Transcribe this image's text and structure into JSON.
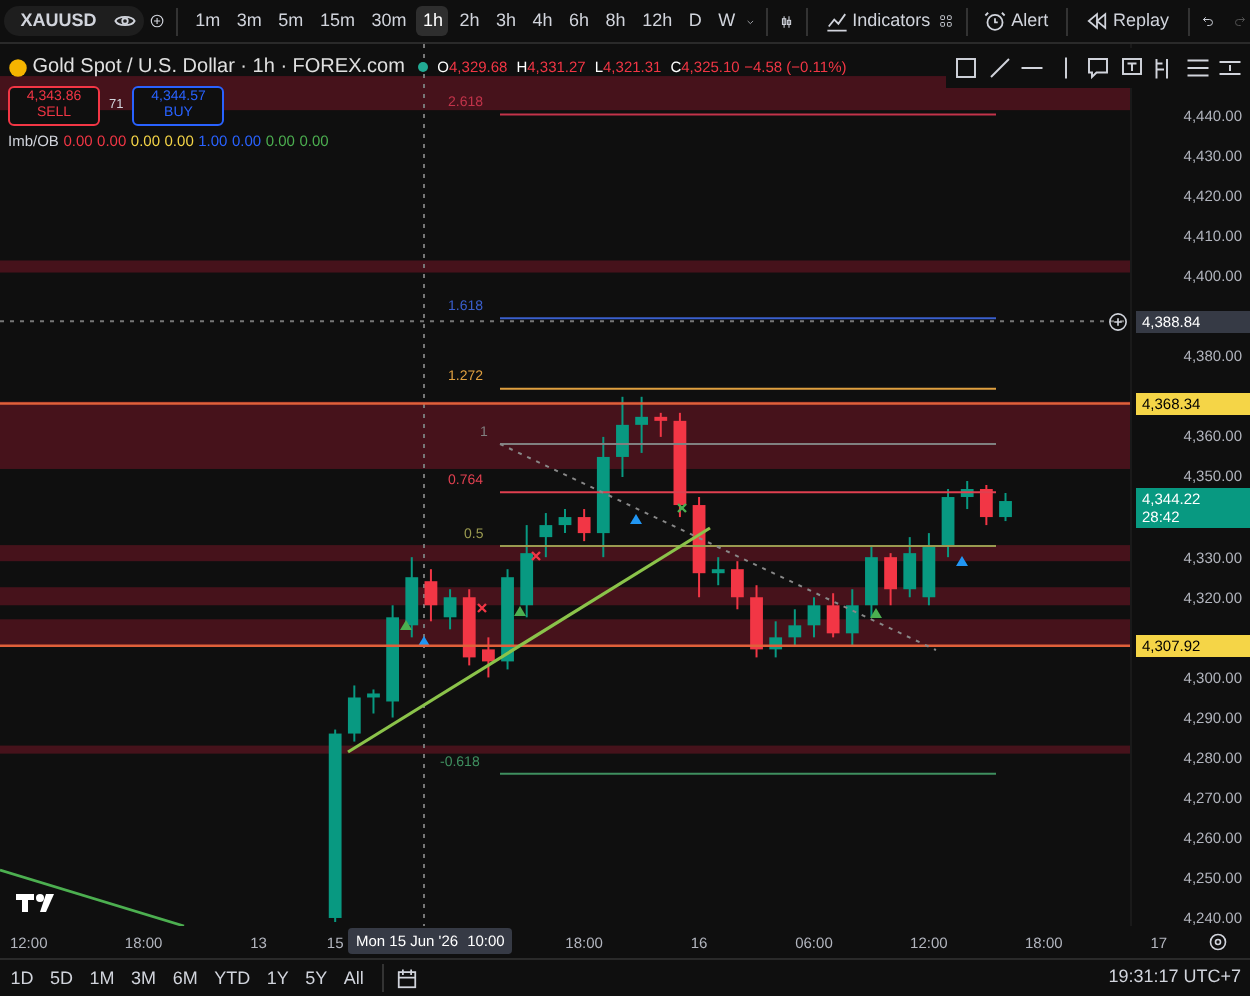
{
  "toolbar": {
    "symbol": "XAUUSD",
    "intervals": [
      {
        "label": "1m",
        "selected": false
      },
      {
        "label": "3m",
        "selected": false
      },
      {
        "label": "5m",
        "selected": false
      },
      {
        "label": "15m",
        "selected": false
      },
      {
        "label": "30m",
        "selected": false
      },
      {
        "label": "1h",
        "selected": true
      },
      {
        "label": "2h",
        "selected": false
      },
      {
        "label": "3h",
        "selected": false
      },
      {
        "label": "4h",
        "selected": false
      },
      {
        "label": "6h",
        "selected": false
      },
      {
        "label": "8h",
        "selected": false
      },
      {
        "label": "12h",
        "selected": false
      },
      {
        "label": "D",
        "selected": false
      },
      {
        "label": "W",
        "selected": false
      }
    ],
    "buttons": [
      {
        "kind": "indicators",
        "label": "Indicators"
      },
      {
        "kind": "alert",
        "label": "Alert"
      },
      {
        "kind": "replay",
        "label": "Replay"
      }
    ]
  },
  "legend": {
    "title": "Gold Spot / U.S. Dollar · 1h · FOREX.com",
    "ohlc": [
      {
        "key": "O",
        "value": "4,329.68"
      },
      {
        "key": "H",
        "value": "4,331.27"
      },
      {
        "key": "L",
        "value": "4,321.31"
      },
      {
        "key": "C",
        "value": "4,325.10"
      }
    ],
    "change": "−4.58 (−0.11%)",
    "sell": {
      "price": "4,343.86",
      "label": "SELL"
    },
    "spread": "71",
    "buy": {
      "price": "4,344.57",
      "label": "BUY"
    },
    "indicator": {
      "name": "Imb/OB",
      "values": [
        {
          "text": "0.00",
          "color": "#f23645"
        },
        {
          "text": "0.00",
          "color": "#f23645"
        },
        {
          "text": "0.00",
          "color": "#f5d547"
        },
        {
          "text": "0.00",
          "color": "#f5d547"
        },
        {
          "text": "1.00",
          "color": "#2962ff"
        },
        {
          "text": "0.00",
          "color": "#2962ff"
        },
        {
          "text": "0.00",
          "color": "#4caf50"
        },
        {
          "text": "0.00",
          "color": "#4caf50"
        }
      ]
    }
  },
  "chart": {
    "chart_data": {
      "type": "candlestick",
      "categories": [
        null,
        null,
        null,
        null,
        null,
        null,
        null,
        null,
        null,
        null,
        null,
        null,
        null,
        null,
        null,
        null,
        null,
        null,
        null,
        null,
        null,
        null,
        null,
        null,
        null,
        null,
        null,
        null,
        null,
        null,
        null,
        null,
        null,
        null,
        null,
        null,
        null,
        null,
        null,
        null,
        null,
        null,
        null,
        null,
        null,
        null,
        null,
        null,
        null,
        null,
        null,
        null,
        null,
        null,
        null,
        null,
        null,
        null,
        null
      ],
      "ylim": [
        4238,
        4458
      ],
      "ohlc": [
        null,
        null,
        null,
        null,
        null,
        null,
        null,
        null,
        null,
        null,
        null,
        null,
        null,
        null,
        null,
        null,
        null,
        [
          4240,
          4287,
          4239,
          4286
        ],
        [
          4286,
          4298,
          4284,
          4295
        ],
        [
          4295,
          4297,
          4291,
          4296
        ],
        [
          4294,
          4318,
          4290,
          4315
        ],
        [
          4313,
          4330,
          4310,
          4325
        ],
        [
          4324,
          4327,
          4314,
          4318
        ],
        [
          4315,
          4322,
          4312,
          4320
        ],
        [
          4320,
          4322,
          4303,
          4305
        ],
        [
          4307,
          4310,
          4300,
          4304
        ],
        [
          4304,
          4327,
          4302,
          4325
        ],
        [
          4318,
          4338,
          4315,
          4331
        ],
        [
          4335,
          4341,
          4330,
          4338
        ],
        [
          4338,
          4342,
          4336,
          4340
        ],
        [
          4340,
          4342,
          4334,
          4336
        ],
        [
          4336,
          4360,
          4330,
          4355
        ],
        [
          4355,
          4370,
          4350,
          4363
        ],
        [
          4363,
          4370,
          4356,
          4365
        ],
        [
          4365,
          4366,
          4360,
          4364
        ],
        [
          4364,
          4366,
          4340,
          4343
        ],
        [
          4343,
          4345,
          4320,
          4326
        ],
        [
          4326,
          4330,
          4323,
          4327
        ],
        [
          4327,
          4329,
          4317,
          4320
        ],
        [
          4320,
          4323,
          4305,
          4307
        ],
        [
          4307,
          4314,
          4305,
          4310
        ],
        [
          4310,
          4317,
          4308,
          4313
        ],
        [
          4313,
          4320,
          4310,
          4318
        ],
        [
          4318,
          4321,
          4310,
          4311
        ],
        [
          4311,
          4322,
          4308,
          4318
        ],
        [
          4318,
          4333,
          4315,
          4330
        ],
        [
          4330,
          4331,
          4318,
          4322
        ],
        [
          4322,
          4335,
          4320,
          4331
        ],
        [
          4320,
          4336,
          4318,
          4333
        ],
        [
          4333,
          4347,
          4330,
          4345
        ],
        [
          4345,
          4349,
          4342,
          4347
        ],
        [
          4347,
          4348,
          4338,
          4340
        ],
        [
          4340,
          4346,
          4339,
          4344
        ],
        null,
        null,
        null,
        null,
        null,
        null
      ],
      "yticks": [
        {
          "value": 4440,
          "label": "4,440.00"
        },
        {
          "value": 4430,
          "label": "4,430.00"
        },
        {
          "value": 4420,
          "label": "4,420.00"
        },
        {
          "value": 4410,
          "label": "4,410.00"
        },
        {
          "value": 4400,
          "label": "4,400.00"
        },
        {
          "value": 4380,
          "label": "4,380.00"
        },
        {
          "value": 4360,
          "label": "4,360.00"
        },
        {
          "value": 4350,
          "label": "4,350.00"
        },
        {
          "value": 4330,
          "label": "4,330.00"
        },
        {
          "value": 4320,
          "label": "4,320.00"
        },
        {
          "value": 4300,
          "label": "4,300.00"
        },
        {
          "value": 4290,
          "label": "4,290.00"
        },
        {
          "value": 4280,
          "label": "4,280.00"
        },
        {
          "value": 4270,
          "label": "4,270.00"
        },
        {
          "value": 4260,
          "label": "4,260.00"
        },
        {
          "value": 4250,
          "label": "4,250.00"
        },
        {
          "value": 4240,
          "label": "4,240.00"
        }
      ]
    }
  },
  "fib_levels": [
    {
      "label": "2.618",
      "color": "#c2334a"
    },
    {
      "label": "1.618",
      "color": "#3a5fcd"
    },
    {
      "label": "1.272",
      "color": "#e0a040"
    },
    {
      "label": "1",
      "color": "#808080"
    },
    {
      "label": "0.764",
      "color": "#e04050"
    },
    {
      "label": "0.5",
      "color": "#9a9a50"
    },
    {
      "label": "-0.618",
      "color": "#3f8f5f"
    }
  ],
  "price_axis": {
    "labels": [
      {
        "kind": "crosshair",
        "text": "4,388.84"
      },
      {
        "kind": "level",
        "text": "4,368.34"
      },
      {
        "kind": "last",
        "text": "4,344.22",
        "timer": "28:42"
      },
      {
        "kind": "level",
        "text": "4,307.92"
      }
    ]
  },
  "time_axis": {
    "ticks": [
      "12:00",
      "18:00",
      "13",
      "15",
      "18:00",
      "16",
      "06:00",
      "12:00",
      "18:00",
      "17"
    ],
    "crosshair": {
      "date": "Mon 15 Jun '26",
      "time": "10:00"
    }
  },
  "bottom_bar": {
    "ranges": [
      "1D",
      "5D",
      "1M",
      "3M",
      "6M",
      "YTD",
      "1Y",
      "5Y",
      "All"
    ],
    "clock": "19:31:17 UTC+7"
  }
}
